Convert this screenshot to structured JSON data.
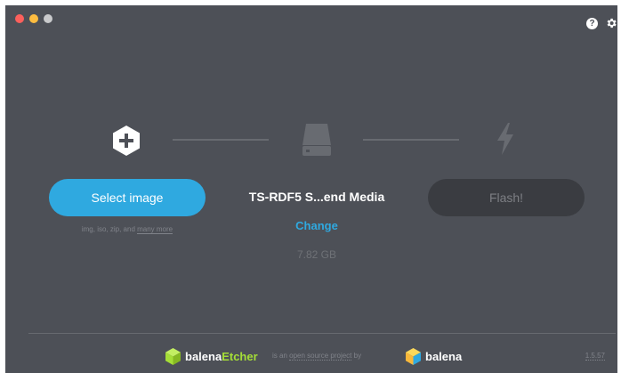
{
  "window": {
    "controls": [
      "close",
      "minimize",
      "zoom"
    ]
  },
  "header": {
    "help_icon": "question-circle-icon",
    "settings_icon": "gear-icon"
  },
  "steps": {
    "image": {
      "icon": "plus-hexagon-icon",
      "button_label": "Select image",
      "formats_prefix": "img, iso, zip, and ",
      "formats_more": "many more"
    },
    "drive": {
      "icon": "drive-icon",
      "name": "TS-RDF5 S...end Media",
      "change_label": "Change",
      "size": "7.82 GB"
    },
    "flash": {
      "icon": "lightning-icon",
      "button_label": "Flash!"
    }
  },
  "footer": {
    "brand_prefix": "balena",
    "brand_suffix": "Etcher",
    "tagline_prefix": "is an ",
    "tagline_link": "open source project",
    "tagline_suffix": " by",
    "company": "balena",
    "version": "1.5.57"
  },
  "colors": {
    "background": "#4d5057",
    "accent": "#2fa9e0",
    "brand_green": "#a5de37",
    "disabled_button": "#3a3c41"
  }
}
